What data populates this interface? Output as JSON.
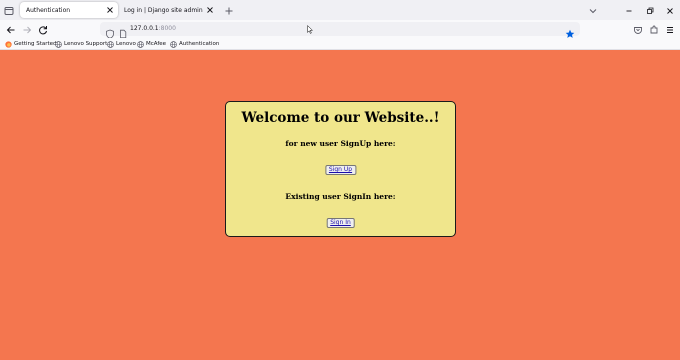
{
  "browser": {
    "tabs": [
      {
        "title": "Authentication",
        "active": true
      },
      {
        "title": "Log in | Django site admin",
        "active": false
      }
    ],
    "url": {
      "host": "127.0.0.1",
      "port": ":8000"
    },
    "bookmarks": [
      {
        "label": "Getting Started",
        "icon": "firefox-icon"
      },
      {
        "label": "Lenovo Support",
        "icon": "globe-icon"
      },
      {
        "label": "Lenovo",
        "icon": "globe-icon"
      },
      {
        "label": "McAfee",
        "icon": "globe-icon"
      },
      {
        "label": "Authentication",
        "icon": "globe-icon"
      }
    ]
  },
  "page": {
    "welcome": "Welcome to our Website..!",
    "new_user_text": "for new user SignUp here:",
    "signup_button": "Sign Up",
    "existing_user_text": "Existing user SignIn here:",
    "signin_button": "Sign In"
  },
  "colors": {
    "page_background": "#f4764f",
    "card_background": "#f0e68c",
    "star_active": "#0060df"
  }
}
